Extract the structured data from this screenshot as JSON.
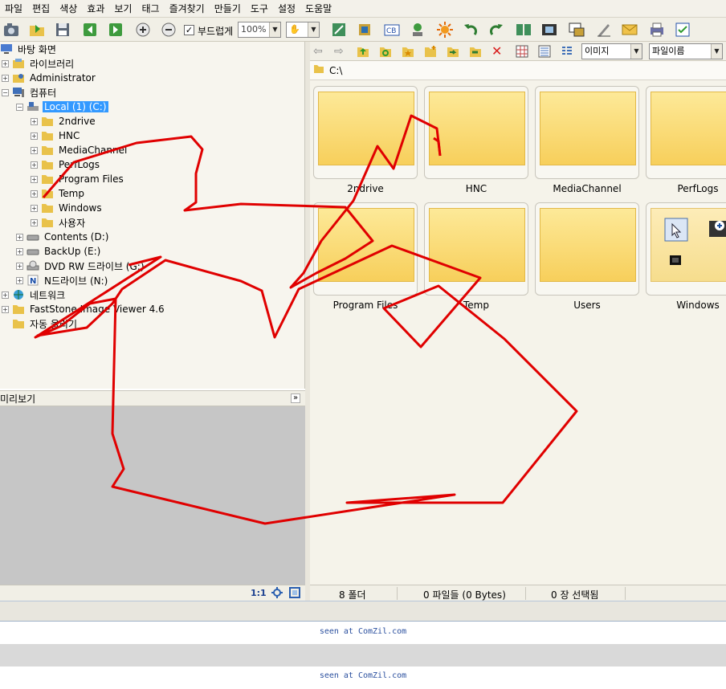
{
  "menu": [
    "파일",
    "편집",
    "색상",
    "효과",
    "보기",
    "태그",
    "즐겨찾기",
    "만들기",
    "도구",
    "설정",
    "도움말"
  ],
  "toolbar": {
    "smooth_label": "부드럽게",
    "zoom_value": "100%",
    "view_mode": "이미지",
    "sort_mode": "파일이름"
  },
  "tree": {
    "desktop": "바탕 화면",
    "library": "라이브러리",
    "admin": "Administrator",
    "computer": "컴퓨터",
    "local_c": "Local (1) (C:)",
    "folders": [
      "2ndrive",
      "HNC",
      "MediaChannel",
      "PerfLogs",
      "Program Files",
      "Temp",
      "Windows",
      "사용자"
    ],
    "drive_d": "Contents (D:)",
    "drive_e": "BackUp (E:)",
    "drive_g": "DVD RW 드라이브 (G:)",
    "drive_n": "N드라이브 (N:)",
    "network": "네트워크",
    "faststone": "FastStone Image Viewer 4.6",
    "autoplay": "자동 올리기"
  },
  "preview": {
    "title": "미리보기",
    "ratio": "1:1"
  },
  "path": "C:\\",
  "thumbnails": [
    "2ndrive",
    "HNC",
    "MediaChannel",
    "PerfLogs",
    "Program Files",
    "Temp",
    "Users",
    "Windows"
  ],
  "status": {
    "folders": "8 폴더",
    "files": "0 파일들 (0 Bytes)",
    "selected": "0 장 선택됨"
  },
  "captions": {
    "top": "seen at ComZil.com",
    "bottom": "seen at ComZil.com"
  },
  "colors": {
    "selection": "#3399ff",
    "scribble": "#e00000",
    "folder": "#f7cf5b"
  }
}
